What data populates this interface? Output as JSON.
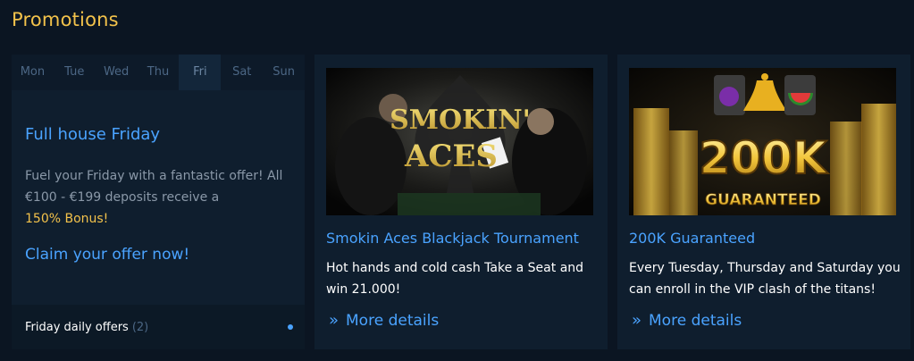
{
  "page": {
    "title": "Promotions"
  },
  "daily": {
    "days": [
      {
        "label": "Mon"
      },
      {
        "label": "Tue"
      },
      {
        "label": "Wed"
      },
      {
        "label": "Thu"
      },
      {
        "label": "Fri",
        "active": true
      },
      {
        "label": "Sat"
      },
      {
        "label": "Sun"
      }
    ],
    "offer_title": "Full house Friday",
    "offer_desc": "Fuel your Friday with a fantastic offer! All €100 - €199 deposits receive a",
    "offer_bonus": "150% Bonus!",
    "offer_cta": "Claim your offer now!",
    "footer_label": "Friday daily offers",
    "footer_count": "(2)"
  },
  "promos": [
    {
      "image_text_1": "SMOKIN'",
      "image_text_2": "ACES",
      "title": "Smokin Aces Blackjack Tournament",
      "desc": "Hot hands and cold cash Take a Seat and win 21.000!",
      "more": "More details"
    },
    {
      "image_text_1": "200K",
      "image_text_2": "GUARANTEED",
      "title": "200K Guaranteed",
      "desc": "Every Tuesday, Thursday and Saturday you can enroll in the VIP clash of the titans!",
      "more": "More details"
    }
  ],
  "colors": {
    "accent_blue": "#4aa3ff",
    "accent_gold": "#f3c24b",
    "background": "#0b1522",
    "card": "#0f1e2e"
  },
  "icons": {
    "more_chevron": "double-chevron-right-icon"
  }
}
